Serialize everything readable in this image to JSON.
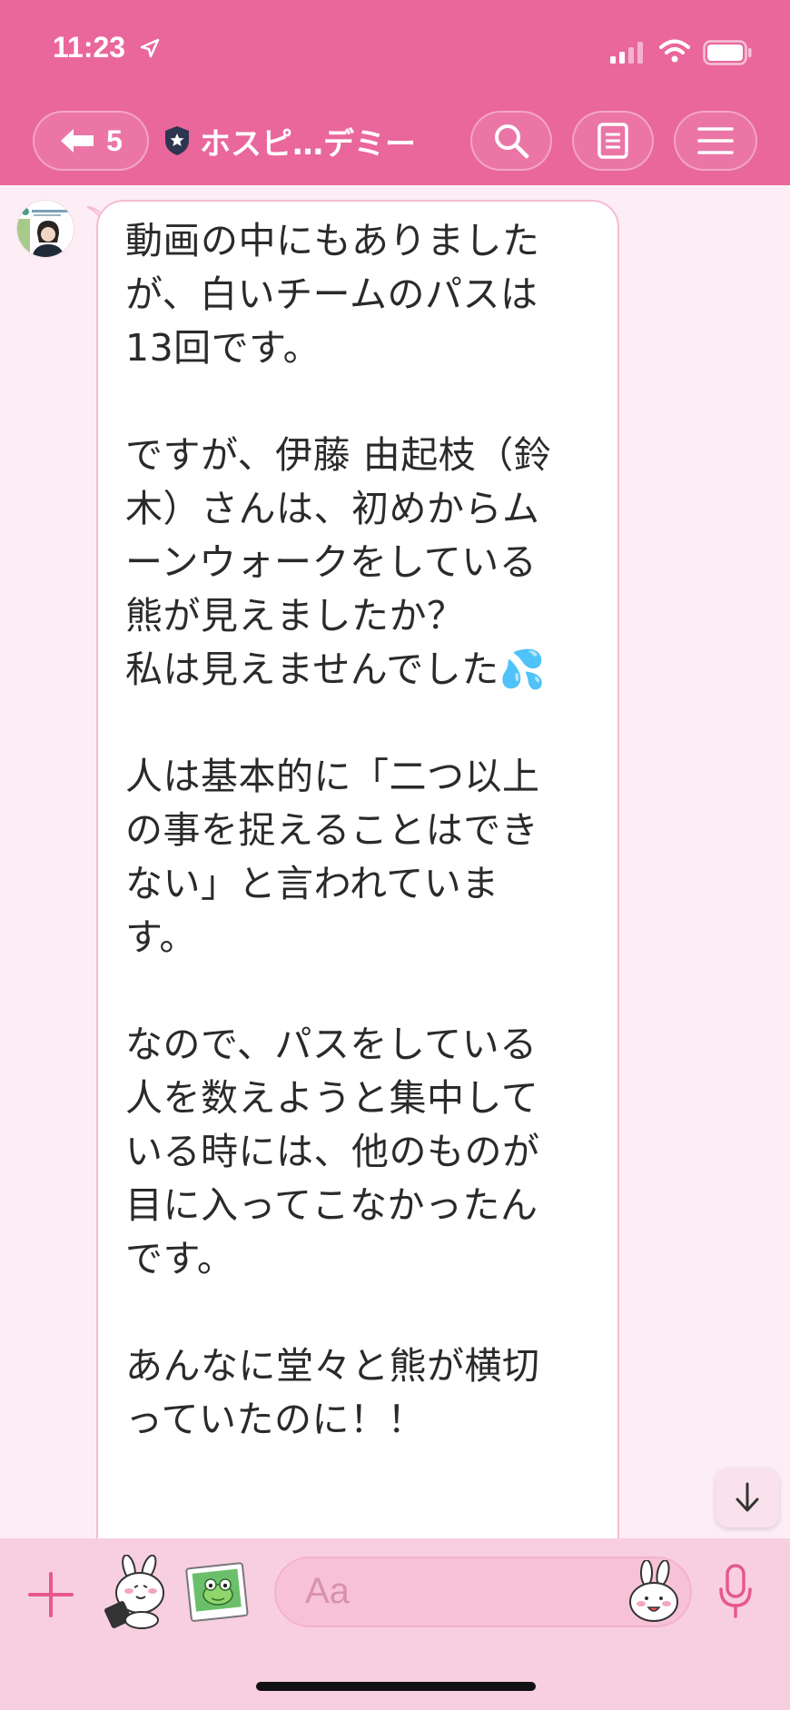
{
  "status_bar": {
    "time": "11:23"
  },
  "header": {
    "back_count": "5",
    "chat_title": "ホスピ…デミー",
    "icons": [
      "back-arrow-icon",
      "shield-star-icon",
      "search-icon",
      "notes-icon",
      "menu-icon"
    ]
  },
  "message": {
    "text": "動画の中にもありました\nが、白いチームのパスは\n13回です。\n\nですが、伊藤 由起枝（鈴\n木）さんは、初めからム\nーンウォークをしている\n熊が見えましたか？\n私は見えませんでした💦\n\n人は基本的に「二つ以上\nの事を捉えることはでき\nない」と言われていま\nす。\n\nなので、パスをしている\n人を数えようと集中して\nいる時には、他のものが\n目に入ってこなかったん\nです。\n\nあんなに堂々と熊が横切\nっていたのに！！"
  },
  "input": {
    "placeholder": "Aa"
  },
  "colors": {
    "header": "#e9679b",
    "chat_background": "#fdeef5",
    "bubble_border": "#f4bcd5",
    "input_bar": "#f8cfe0",
    "accent": "#e7588f"
  }
}
